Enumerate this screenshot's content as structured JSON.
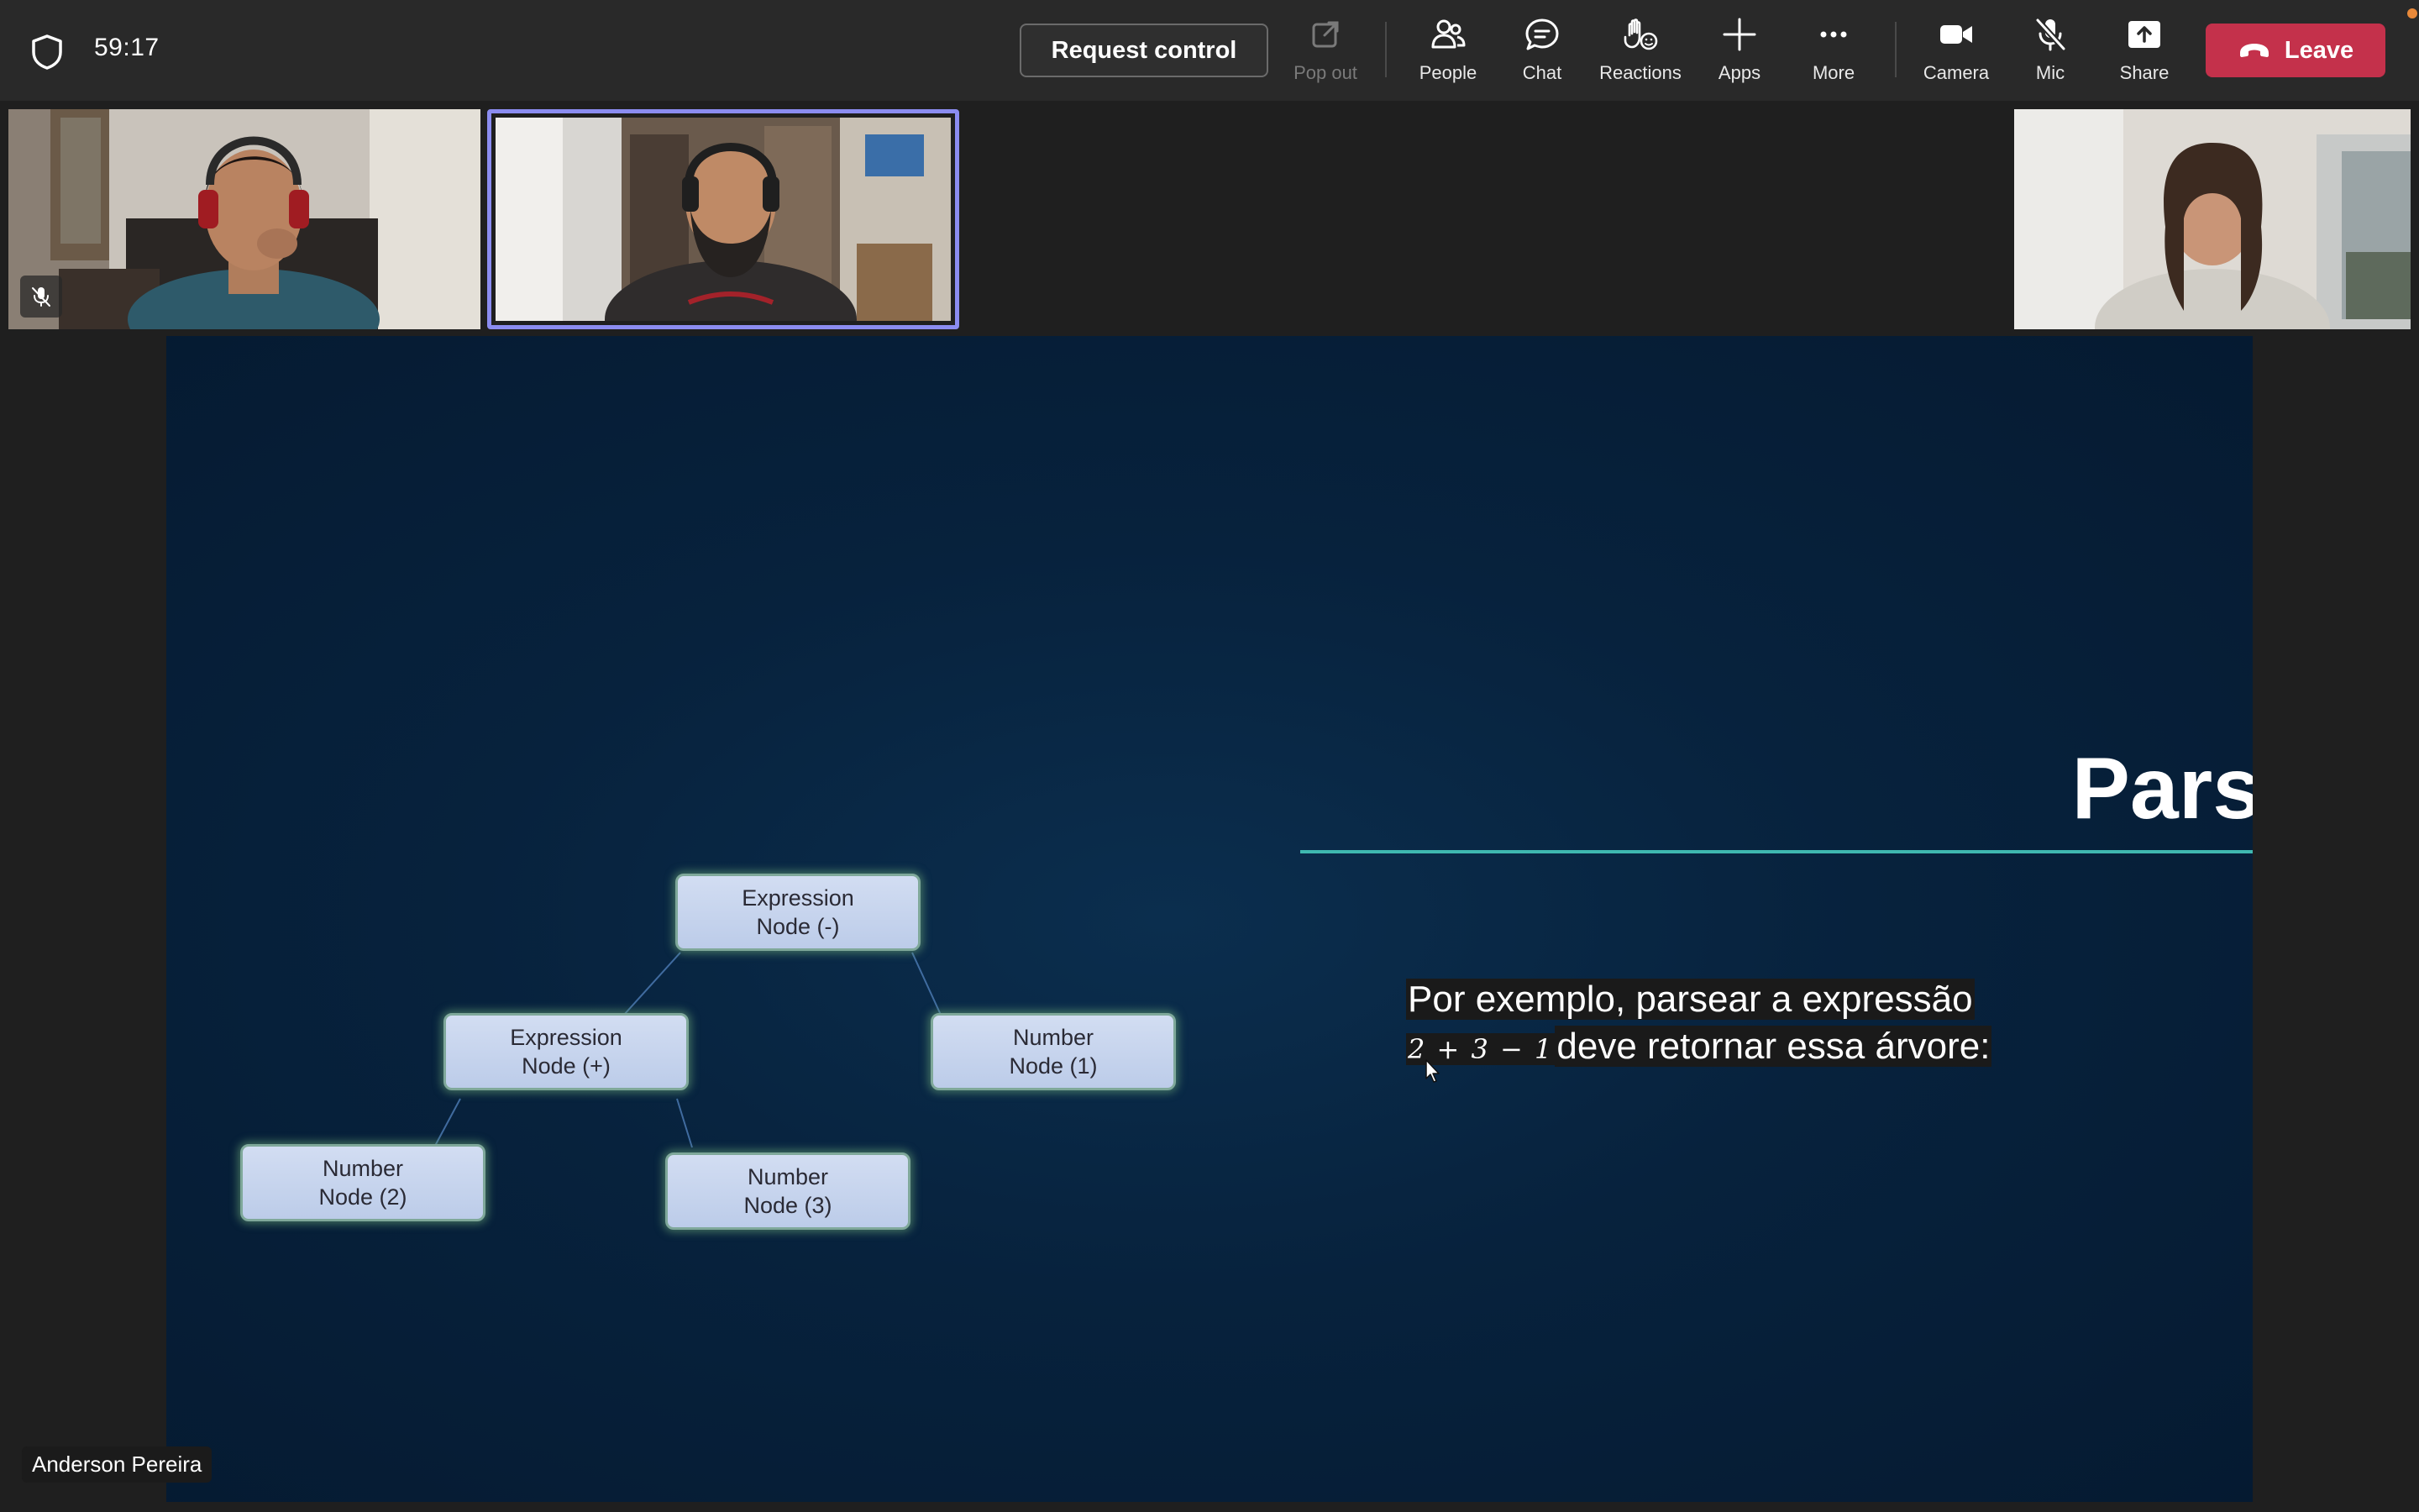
{
  "toolbar": {
    "timer": "59:17",
    "request_control": "Request control",
    "items": [
      {
        "label": "Pop out",
        "icon": "pop-out-icon"
      },
      {
        "label": "People",
        "icon": "people-icon"
      },
      {
        "label": "Chat",
        "icon": "chat-icon"
      },
      {
        "label": "Reactions",
        "icon": "reactions-icon"
      },
      {
        "label": "Apps",
        "icon": "apps-icon"
      },
      {
        "label": "More",
        "icon": "more-icon"
      },
      {
        "label": "Camera",
        "icon": "camera-icon"
      },
      {
        "label": "Mic",
        "icon": "mic-off-icon"
      },
      {
        "label": "Share",
        "icon": "share-icon"
      }
    ],
    "leave": "Leave",
    "leave_color": "#c4314b",
    "active_speaker_border": "#8b8cf0"
  },
  "slide": {
    "title": "Parsing",
    "text_line1": "Por exemplo, parsear a expressão",
    "expression": "2 + 3 − 1",
    "text_line2_rest": "deve retornar essa árvore:",
    "nodes": [
      {
        "line1": "Expression",
        "line2": "Node (-)"
      },
      {
        "line1": "Expression",
        "line2": "Node (+)"
      },
      {
        "line1": "Number",
        "line2": "Node (1)"
      },
      {
        "line1": "Number",
        "line2": "Node (2)"
      },
      {
        "line1": "Number",
        "line2": "Node (3)"
      }
    ],
    "accent_line_color": "#3fb8b0"
  },
  "presenter_name": "Anderson Pereira"
}
